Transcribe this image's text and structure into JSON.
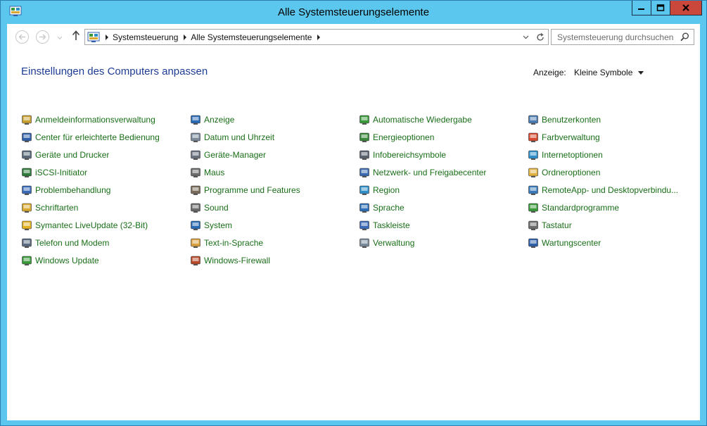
{
  "window": {
    "title": "Alle Systemsteuerungselemente"
  },
  "address": {
    "crumbs": [
      "Systemsteuerung",
      "Alle Systemsteuerungselemente"
    ]
  },
  "search": {
    "placeholder": "Systemsteuerung durchsuchen"
  },
  "main": {
    "heading": "Einstellungen des Computers anpassen",
    "view_label": "Anzeige:",
    "view_value": "Kleine Symbole"
  },
  "colors": {
    "title_bar": "#5bc7ee",
    "close_button": "#c9483b",
    "heading": "#1e3b95",
    "link": "#196e18"
  },
  "items": [
    {
      "label": "Anmeldeinformationsverwaltung",
      "icon": "credential-vault-icon",
      "color": "#c8a030"
    },
    {
      "label": "Anzeige",
      "icon": "display-icon",
      "color": "#2a6bb5"
    },
    {
      "label": "Automatische Wiedergabe",
      "icon": "autoplay-icon",
      "color": "#3a9a3a"
    },
    {
      "label": "Benutzerkonten",
      "icon": "user-accounts-icon",
      "color": "#4a7ab0"
    },
    {
      "label": "Center für erleichterte Bedienung",
      "icon": "ease-of-access-icon",
      "color": "#2f5fa8"
    },
    {
      "label": "Datum und Uhrzeit",
      "icon": "date-time-icon",
      "color": "#7a8a9a"
    },
    {
      "label": "Energieoptionen",
      "icon": "power-options-icon",
      "color": "#3b8a3b"
    },
    {
      "label": "Farbverwaltung",
      "icon": "color-management-icon",
      "color": "#d6492f"
    },
    {
      "label": "Geräte und Drucker",
      "icon": "devices-printers-icon",
      "color": "#5a6a7a"
    },
    {
      "label": "Geräte-Manager",
      "icon": "device-manager-icon",
      "color": "#6a7280"
    },
    {
      "label": "Infobereichsymbole",
      "icon": "notification-icons-icon",
      "color": "#5a6270"
    },
    {
      "label": "Internetoptionen",
      "icon": "internet-options-icon",
      "color": "#2f8fc8"
    },
    {
      "label": "iSCSI-Initiator",
      "icon": "iscsi-initiator-icon",
      "color": "#2f7a3a"
    },
    {
      "label": "Maus",
      "icon": "mouse-icon",
      "color": "#6b6b6b"
    },
    {
      "label": "Netzwerk- und Freigabecenter",
      "icon": "network-sharing-icon",
      "color": "#3a6ab0"
    },
    {
      "label": "Ordneroptionen",
      "icon": "folder-options-icon",
      "color": "#e0b040"
    },
    {
      "label": "Problembehandlung",
      "icon": "troubleshooting-icon",
      "color": "#3a6ab8"
    },
    {
      "label": "Programme und Features",
      "icon": "programs-features-icon",
      "color": "#7a6a5a"
    },
    {
      "label": "Region",
      "icon": "region-icon",
      "color": "#2f8fc8"
    },
    {
      "label": "RemoteApp- und Desktopverbindu...",
      "icon": "remoteapp-icon",
      "color": "#3a7ab8"
    },
    {
      "label": "Schriftarten",
      "icon": "fonts-icon",
      "color": "#d8a830"
    },
    {
      "label": "Sound",
      "icon": "sound-icon",
      "color": "#6b6b6b"
    },
    {
      "label": "Sprache",
      "icon": "language-icon",
      "color": "#2f6fb8"
    },
    {
      "label": "Standardprogramme",
      "icon": "default-programs-icon",
      "color": "#3a9a3a"
    },
    {
      "label": "Symantec LiveUpdate (32-Bit)",
      "icon": "symantec-liveupdate-icon",
      "color": "#e0b020"
    },
    {
      "label": "System",
      "icon": "system-icon",
      "color": "#2a6bb5"
    },
    {
      "label": "Taskleiste",
      "icon": "taskbar-icon",
      "color": "#3a6ab8"
    },
    {
      "label": "Tastatur",
      "icon": "keyboard-icon",
      "color": "#6b6b6b"
    },
    {
      "label": "Telefon und Modem",
      "icon": "phone-modem-icon",
      "color": "#5a6a80"
    },
    {
      "label": "Text-in-Sprache",
      "icon": "text-to-speech-icon",
      "color": "#d8a040"
    },
    {
      "label": "Verwaltung",
      "icon": "administrative-tools-icon",
      "color": "#7a8a9a"
    },
    {
      "label": "Wartungscenter",
      "icon": "action-center-icon",
      "color": "#2f5fa8"
    },
    {
      "label": "Windows Update",
      "icon": "windows-update-icon",
      "color": "#3a9a3a"
    },
    {
      "label": "Windows-Firewall",
      "icon": "windows-firewall-icon",
      "color": "#b84a2a"
    }
  ]
}
